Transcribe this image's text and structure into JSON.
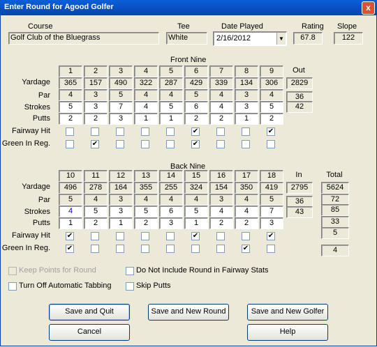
{
  "window": {
    "title": "Enter Round for Agood Golfer",
    "close_glyph": "x"
  },
  "header": {
    "course_label": "Course",
    "course_value": "Golf Club of the Bluegrass",
    "tee_label": "Tee",
    "tee_value": "White",
    "date_label": "Date Played",
    "date_value": "2/16/2012",
    "rating_label": "Rating",
    "rating_value": "67.8",
    "slope_label": "Slope",
    "slope_value": "122"
  },
  "front": {
    "heading": "Front Nine",
    "holes": [
      "1",
      "2",
      "3",
      "4",
      "5",
      "6",
      "7",
      "8",
      "9"
    ],
    "yardage": [
      "365",
      "157",
      "490",
      "322",
      "287",
      "429",
      "339",
      "134",
      "306"
    ],
    "par": [
      "4",
      "3",
      "5",
      "4",
      "4",
      "5",
      "4",
      "3",
      "4"
    ],
    "strokes": [
      "5",
      "3",
      "7",
      "4",
      "5",
      "6",
      "4",
      "3",
      "5"
    ],
    "putts": [
      "2",
      "2",
      "3",
      "1",
      "1",
      "2",
      "2",
      "1",
      "2"
    ],
    "fairway": [
      false,
      false,
      false,
      false,
      false,
      true,
      false,
      false,
      true
    ],
    "gir": [
      false,
      true,
      false,
      false,
      false,
      true,
      false,
      false,
      false
    ],
    "out_label": "Out",
    "out_yardage": "2829",
    "out_par": "36",
    "out_strokes": "42"
  },
  "back": {
    "heading": "Back Nine",
    "holes": [
      "10",
      "11",
      "12",
      "13",
      "14",
      "15",
      "16",
      "17",
      "18"
    ],
    "yardage": [
      "496",
      "278",
      "164",
      "355",
      "255",
      "324",
      "154",
      "350",
      "419"
    ],
    "par": [
      "5",
      "4",
      "3",
      "4",
      "4",
      "4",
      "3",
      "4",
      "5"
    ],
    "strokes": [
      "4",
      "5",
      "3",
      "5",
      "6",
      "5",
      "4",
      "4",
      "7"
    ],
    "putts": [
      "1",
      "2",
      "1",
      "2",
      "3",
      "1",
      "2",
      "2",
      "3"
    ],
    "fairway": [
      true,
      false,
      false,
      false,
      false,
      true,
      false,
      false,
      true
    ],
    "gir": [
      true,
      false,
      false,
      false,
      false,
      false,
      false,
      true,
      false
    ],
    "in_label": "In",
    "in_yardage": "2795",
    "in_par": "36",
    "in_strokes": "43",
    "total_label": "Total",
    "total_yardage": "5624",
    "total_par": "72",
    "total_strokes": "85",
    "total_putts": "33",
    "total_fairways": "5",
    "total_gir": "4"
  },
  "row_labels": {
    "yardage": "Yardage",
    "par": "Par",
    "strokes": "Strokes",
    "putts": "Putts",
    "fairway": "Fairway Hit",
    "gir": "Green In Reg."
  },
  "options": {
    "keep_points": "Keep Points for Round",
    "turn_off_tabbing": "Turn Off Automatic Tabbing",
    "no_fairway_stats": "Do Not Include Round in Fairway Stats",
    "skip_putts": "Skip Putts"
  },
  "buttons": {
    "save_quit": "Save and Quit",
    "save_new_round": "Save and New Round",
    "save_new_golfer": "Save and New Golfer",
    "cancel": "Cancel",
    "help": "Help"
  },
  "colors": {
    "stroke_birdie": "#0000ff",
    "stroke_eagle": "#ff0000",
    "check_mark": "#000000"
  }
}
